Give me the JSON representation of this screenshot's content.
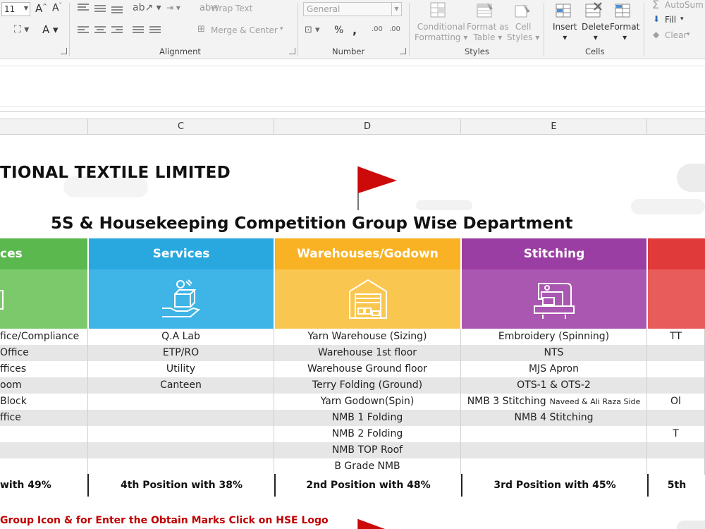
{
  "ribbon": {
    "font_size": "11",
    "wrap_text": "Wrap Text",
    "merge_center": "Merge & Center",
    "number_format": "General",
    "percent": "%",
    "comma": ",",
    "inc_dec": ".00",
    "dec_dec": ".00",
    "conditional_formatting": "Conditional\nFormatting",
    "format_as_table": "Format as\nTable",
    "cell_styles": "Cell\nStyles",
    "insert": "Insert",
    "delete": "Delete",
    "format": "Format",
    "autosum": "AutoSum",
    "fill": "Fill",
    "clear": "Clear",
    "groups": {
      "alignment": "Alignment",
      "number": "Number",
      "styles": "Styles",
      "cells": "Cells"
    }
  },
  "columns": [
    "C",
    "D",
    "E"
  ],
  "sheet": {
    "company": "TIONAL TEXTILE LIMITED",
    "title": "5S & Housekeeping Competition Group Wise Department",
    "note": "Group Icon & for Enter the Obtain Marks Click on HSE Logo",
    "groups": [
      {
        "name": "ces",
        "color": "#5bb84e",
        "icon": "office-icon"
      },
      {
        "name": "Services",
        "color": "#29a8e0",
        "icon": "service-hand-icon"
      },
      {
        "name": "Warehouses/Godown",
        "color": "#f8b224",
        "icon": "warehouse-icon"
      },
      {
        "name": "Stitching",
        "color": "#9b3ea3",
        "icon": "sewing-machine-icon"
      },
      {
        "name": "",
        "color": "#e03a3a",
        "icon": ""
      }
    ],
    "rows": [
      [
        "fice/Compliance",
        "Q.A Lab",
        "Yarn Warehouse (Sizing)",
        "Embroidery (Spinning)",
        "TT"
      ],
      [
        "Office",
        "ETP/RO",
        "Warehouse 1st floor",
        "NTS",
        ""
      ],
      [
        "ffices",
        "Utility",
        "Warehouse Ground floor",
        "MJS Apron",
        ""
      ],
      [
        "oom",
        "Canteen",
        "Terry Folding (Ground)",
        "OTS-1 & OTS-2",
        ""
      ],
      [
        "Block",
        "",
        "Yarn Godown(Spin)",
        "NMB 3 Stitching",
        "Ol"
      ],
      [
        "ffice",
        "",
        "NMB 1 Folding",
        "NMB 4 Stitching",
        ""
      ],
      [
        "",
        "",
        "NMB 2 Folding",
        "",
        "T"
      ],
      [
        "",
        "",
        "NMB TOP Roof",
        "",
        ""
      ],
      [
        "",
        "",
        "B Grade NMB",
        "",
        ""
      ]
    ],
    "row5_small": "Naveed & Ali Raza Side",
    "positions": [
      " with 49%",
      "4th Position with 38%",
      "2nd Position with 48%",
      "3rd Position with 45%",
      "5th"
    ]
  }
}
